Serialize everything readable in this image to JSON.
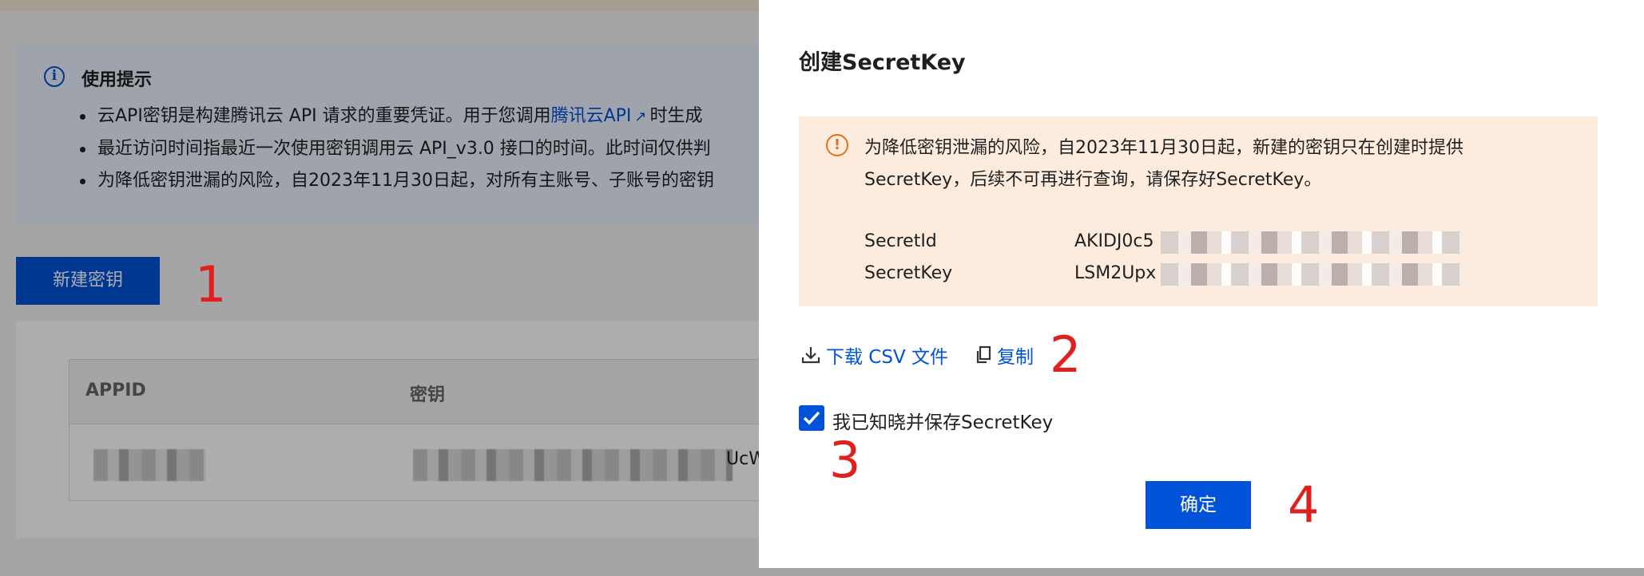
{
  "background": {
    "tip": {
      "title": "使用提示",
      "items": [
        {
          "before": "云API密钥是构建腾讯云 API 请求的重要凭证。用于您调用",
          "link": "腾讯云API",
          "after": "时生成"
        },
        {
          "text": "最近访问时间指最近一次使用密钥调用云 API_v3.0 接口的时间。此时间仅供判"
        },
        {
          "text": "为降低密钥泄漏的风险，自2023年11月30日起，对所有主账号、子账号的密钥"
        }
      ]
    },
    "new_key_button": "新建密钥",
    "table": {
      "headers": [
        "APPID",
        "密钥"
      ],
      "row_partial": "UcW"
    }
  },
  "annotations": [
    "1",
    "2",
    "3",
    "4"
  ],
  "drawer": {
    "title": "创建SecretKey",
    "warning": "为降低密钥泄漏的风险，自2023年11月30日起，新建的密钥只在创建时提供SecretKey，后续不可再进行查询，请保存好SecretKey。",
    "secret_id_label": "SecretId",
    "secret_id_value": "AKIDJ0c5",
    "secret_key_label": "SecretKey",
    "secret_key_value": "LSM2Upx",
    "download_label": "下载 CSV 文件",
    "copy_label": "复制",
    "checkbox_label": "我已知晓并保存SecretKey",
    "checkbox_checked": true,
    "confirm_label": "确定"
  },
  "colors": {
    "accent": "#0052d9",
    "warning_bg": "#fdecde",
    "warning_icon": "#e37318",
    "annotation": "#e0201d"
  }
}
